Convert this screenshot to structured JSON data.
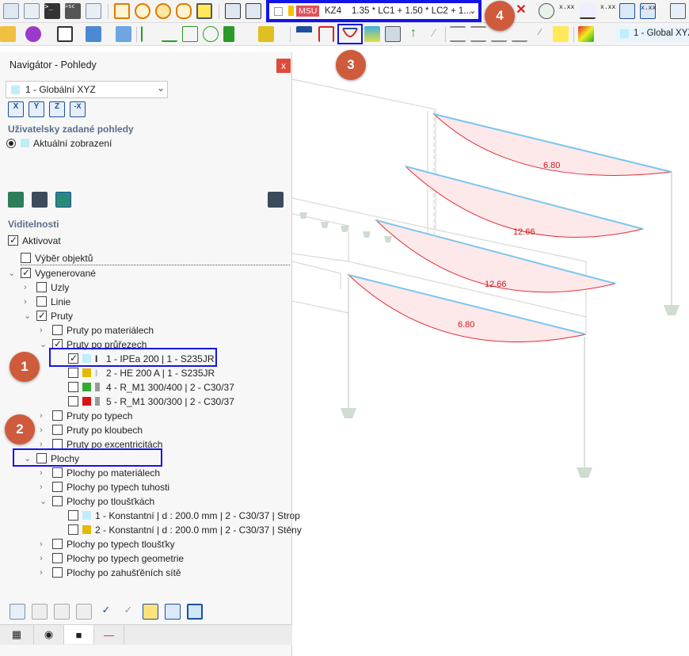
{
  "toolbar": {
    "load_type_badge": "MSU",
    "load_combination_id": "KZ4",
    "load_combination_formula": "1.35 * LC1 + 1.50 * LC2 + 1....",
    "view_label": "1 - Global XYZ",
    "scale_icon_label": "x.xx"
  },
  "callouts": [
    "1",
    "2",
    "3",
    "4"
  ],
  "panel": {
    "title": "Navigátor - Pohledy",
    "close_label": "x",
    "view_combo_value": "1 - Globální XYZ",
    "axis_buttons": [
      "X",
      "Y",
      "Z",
      "-X"
    ],
    "user_views_heading": "Uživatelsky zadané pohledy",
    "current_view_label": "Aktuální zobrazení",
    "visibility_heading": "Viditelnosti",
    "tree": [
      {
        "label": "Aktivovat",
        "checked": true
      },
      {
        "label": "Výběr objektů",
        "checked": false
      },
      {
        "label": "Vygenerované",
        "checked": true
      },
      {
        "label": "Uzly",
        "checked": false
      },
      {
        "label": "Linie",
        "checked": false
      },
      {
        "label": "Pruty",
        "checked": true
      },
      {
        "label": "Pruty po materiálech",
        "checked": false
      },
      {
        "label": "Pruty po průřezech",
        "checked": true
      },
      {
        "label": "1 - IPEa 200 | 1 - S235JR",
        "checked": true
      },
      {
        "label": "2 - HE 200 A | 1 - S235JR",
        "checked": false
      },
      {
        "label": "4 - R_M1 300/400 | 2 - C30/37",
        "checked": false
      },
      {
        "label": "5 - R_M1 300/300 | 2 - C30/37",
        "checked": false
      },
      {
        "label": "Pruty po typech",
        "checked": false
      },
      {
        "label": "Pruty po kloubech",
        "checked": false
      },
      {
        "label": "Pruty po excentricitách",
        "checked": false
      },
      {
        "label": "Plochy",
        "checked": false
      },
      {
        "label": "Plochy po materiálech",
        "checked": false
      },
      {
        "label": "Plochy po typech tuhosti",
        "checked": false
      },
      {
        "label": "Plochy po tloušťkách",
        "checked": false
      },
      {
        "label": "1 - Konstantní | d : 200.0 mm | 2 - C30/37 | Strop",
        "checked": false
      },
      {
        "label": "2 - Konstantní | d : 200.0 mm | 2 - C30/37 | Stěny",
        "checked": false
      },
      {
        "label": "Plochy po typech tloušťky",
        "checked": false
      },
      {
        "label": "Plochy po typech geometrie",
        "checked": false
      },
      {
        "label": "Plochy po zahušťěních sítě",
        "checked": false
      }
    ]
  },
  "results": {
    "values": [
      "6.80",
      "12.66",
      "12.66",
      "6.80"
    ]
  },
  "colors": {
    "highlight": "#1414e6",
    "callout": "#cf5b3d",
    "diagram": "#e0303a",
    "beam": "#7cc6ee",
    "swatch_cyan": "#bfeefa",
    "swatch_yellow": "#e6b800",
    "swatch_green": "#33aa33",
    "swatch_red": "#dd1111"
  }
}
